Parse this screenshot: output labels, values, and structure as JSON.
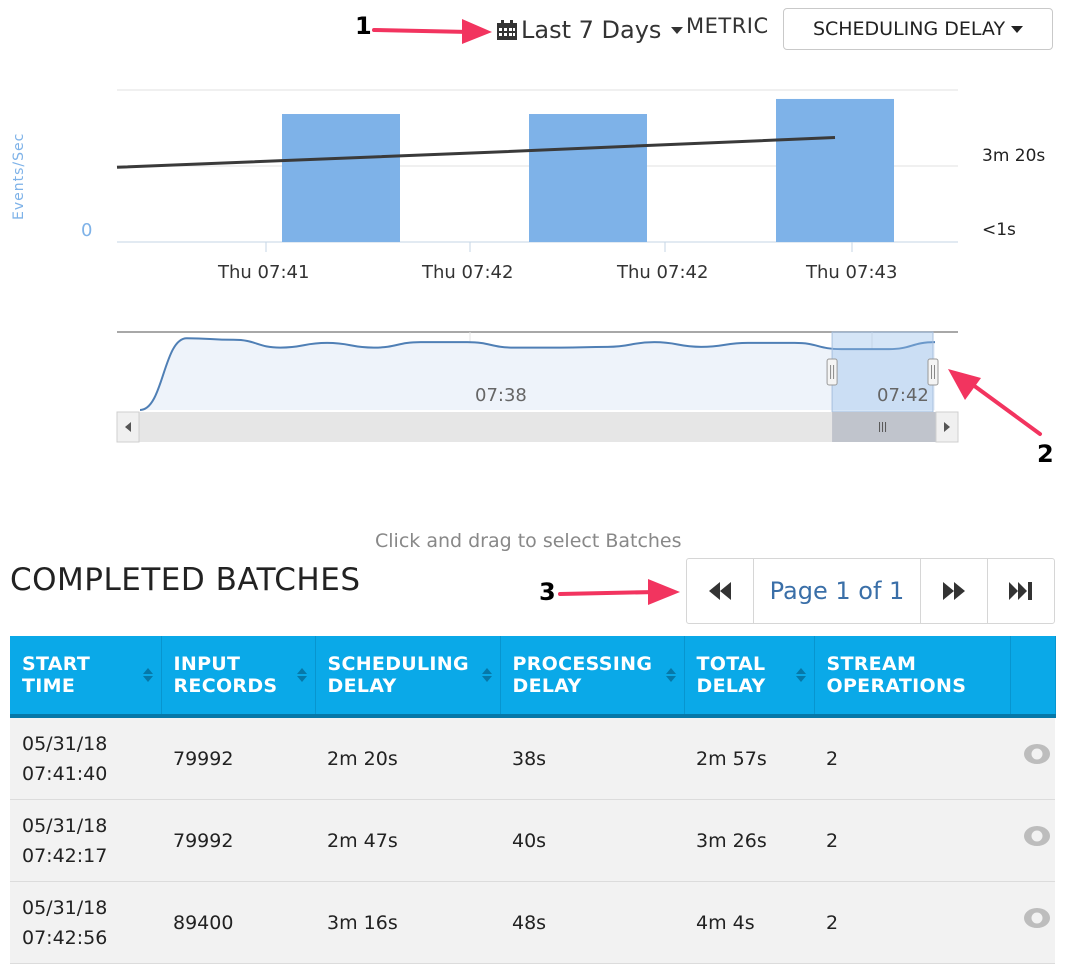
{
  "annotations": {
    "one": "1",
    "two": "2",
    "three": "3"
  },
  "toolbar": {
    "date_range": "Last 7 Days",
    "metric_label": "METRIC",
    "metric_value": "SCHEDULING DELAY",
    "icons": {
      "calendar": "calendar-icon",
      "caret": "caret-down-icon"
    }
  },
  "chart_data": {
    "type": "bar",
    "ylabel": "Events/Sec",
    "y_left_ticks": [
      "0"
    ],
    "y_right_ticks": [
      "3m 20s",
      "<1s"
    ],
    "x_ticks": [
      "Thu 07:41",
      "Thu 07:42",
      "Thu 07:42",
      "Thu 07:43"
    ],
    "bars": {
      "name": "Input Records",
      "values": [
        79992,
        79992,
        89400
      ]
    },
    "line": {
      "name": "Scheduling Delay",
      "values": [
        140,
        167,
        196
      ],
      "unit": "s"
    },
    "ylim_left": [
      0,
      100000
    ],
    "ylim_right": [
      0,
      300
    ],
    "bar_color": "#7eb2e8",
    "line_color": "#3a3a3a",
    "grid": true
  },
  "navigator": {
    "labels": [
      "07:38",
      "07:42"
    ],
    "series": [
      0,
      92,
      90,
      80,
      86,
      80,
      87,
      87,
      80,
      80,
      81,
      87,
      81,
      86,
      86,
      78,
      78,
      87
    ],
    "selection": [
      0.88,
      1.0
    ],
    "scrollbar_icons": {
      "left": "arrow-left-icon",
      "right": "arrow-right-icon",
      "grip": "grip-icon"
    }
  },
  "hint": "Click and drag to select Batches",
  "batches": {
    "title": "COMPLETED BATCHES",
    "pager": {
      "label": "Page 1 of 1"
    },
    "columns": [
      {
        "l1": "START TIME",
        "l2": ""
      },
      {
        "l1": "INPUT",
        "l2": "RECORDS"
      },
      {
        "l1": "SCHEDULING",
        "l2": "DELAY"
      },
      {
        "l1": "PROCESSING",
        "l2": "DELAY"
      },
      {
        "l1": "TOTAL",
        "l2": "DELAY"
      },
      {
        "l1": "STREAM",
        "l2": "OPERATIONS"
      }
    ],
    "rows": [
      {
        "date": "05/31/18",
        "time": "07:41:40",
        "input": "79992",
        "sched": "2m 20s",
        "proc": "38s",
        "total": "2m 57s",
        "ops": "2"
      },
      {
        "date": "05/31/18",
        "time": "07:42:17",
        "input": "79992",
        "sched": "2m 47s",
        "proc": "40s",
        "total": "3m 26s",
        "ops": "2"
      },
      {
        "date": "05/31/18",
        "time": "07:42:56",
        "input": "89400",
        "sched": "3m 16s",
        "proc": "48s",
        "total": "4m 4s",
        "ops": "2"
      }
    ]
  },
  "colors": {
    "accent": "#0aa9e8",
    "header_border": "#0678a8",
    "pager_text": "#3a6fa8",
    "annotation_arrow": "#f2345f"
  }
}
